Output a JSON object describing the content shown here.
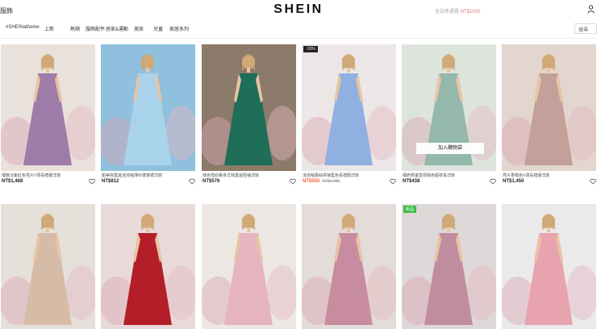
{
  "header": {
    "left_text": "服飾",
    "logo": "SHEIN",
    "promo_text": "全站免運費",
    "promo_highlight": "NT$1000",
    "user_icon": "user-icon"
  },
  "nav": {
    "items": [
      "#SHEINathome",
      "上新",
      "熱銷",
      "服飾配件",
      "居家&運動",
      "美妝",
      "兒童",
      "家居系列"
    ],
    "search_label": "搜尋"
  },
  "products": [
    {
      "name": "優雅淡紫紅色亮片V領長禮服洋裝",
      "price": "NT$1,468",
      "badge": "",
      "dress_color": "#9e7ba8",
      "bg": "#e9e1db"
    },
    {
      "name": "甜美荷葉邊泡泡袖薄紗蓬蓬裙洋裝",
      "price": "NT$812",
      "badge": "",
      "dress_color": "#a9d3ea",
      "bg": "#8fc0dd"
    },
    {
      "name": "綠色雪紡裹身式荷葉邊短袖洋裝",
      "price": "NT$576",
      "badge": "",
      "dress_color": "#1e6e58",
      "bg": "#8c7a6a"
    },
    {
      "name": "泡泡袖蕾絲拼接藍色長禮服洋裝",
      "price": "NT$550",
      "orig_price": "NT$1,459",
      "badge": "-15%",
      "dress_color": "#8fb0e0",
      "bg": "#ece7e6"
    },
    {
      "name": "細肩帶垂墜領綠色開衩長洋裝",
      "price": "NT$438",
      "badge": "",
      "dress_color": "#94b8ac",
      "bg": "#dde4dc",
      "add_to_cart": "加入購物袋"
    },
    {
      "name": "亮片香檳色V領長禮服洋裝",
      "price": "NT$1,450",
      "badge": "",
      "dress_color": "#c4a09a",
      "bg": "#e2d6ce"
    },
    {
      "name": "",
      "price": "",
      "badge": "",
      "dress_color": "#d6bba7",
      "bg": "#e6e0da"
    },
    {
      "name": "",
      "price": "",
      "badge": "",
      "dress_color": "#b41e28",
      "bg": "#e9dada"
    },
    {
      "name": "",
      "price": "",
      "badge": "",
      "dress_color": "#e6b3c1",
      "bg": "#ece7e3"
    },
    {
      "name": "",
      "price": "",
      "badge": "",
      "dress_color": "#c88ca0",
      "bg": "#e3dcd8"
    },
    {
      "name": "",
      "price": "",
      "badge": "新品",
      "dress_color": "#c08ca0",
      "bg": "#ded8d8"
    },
    {
      "name": "",
      "price": "",
      "badge": "",
      "dress_color": "#e8a4ae",
      "bg": "#eaeaea"
    }
  ],
  "icons": {
    "heart": "heart-icon",
    "user": "user-icon"
  }
}
